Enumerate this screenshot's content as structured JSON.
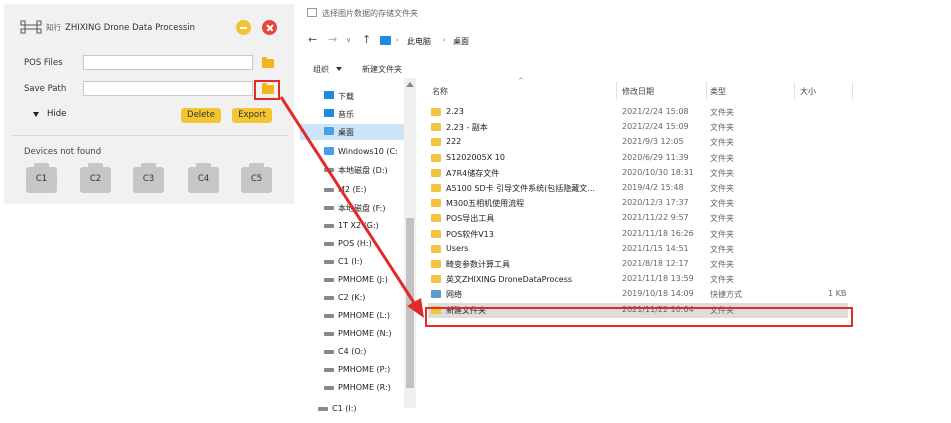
{
  "app": {
    "title": "ZHIXING Drone Data Processin",
    "logo_text": "知行",
    "pos_files_label": "POS Files",
    "pos_files_value": "",
    "save_path_label": "Save Path",
    "save_path_value": "",
    "hide_label": "Hide",
    "delete_label": "Delete",
    "export_label": "Export",
    "devices_title": "Devices not found",
    "devices": [
      "C1",
      "C2",
      "C3",
      "C4",
      "C5"
    ]
  },
  "explorer": {
    "title": "选择图片数据的存储文件夹",
    "breadcrumb": [
      "此电脑",
      "桌面"
    ],
    "organize_label": "组织",
    "new_folder_label": "新建文件夹",
    "columns": [
      "名称",
      "修改日期",
      "类型",
      "大小"
    ],
    "nav_items": [
      {
        "label": "下载",
        "icon": "download-icon"
      },
      {
        "label": "音乐",
        "icon": "music-icon"
      },
      {
        "label": "桌面",
        "icon": "desktop-icon",
        "selected": true
      },
      {
        "label": "Windows10 (C:",
        "icon": "windows-drive-icon"
      },
      {
        "label": "本地磁盘 (D:)",
        "icon": "drive-icon"
      },
      {
        "label": "M2 (E:)",
        "icon": "drive-icon"
      },
      {
        "label": "本地磁盘 (F:)",
        "icon": "drive-icon"
      },
      {
        "label": "1T X2 (G:)",
        "icon": "drive-icon"
      },
      {
        "label": "POS (H:)",
        "icon": "drive-icon"
      },
      {
        "label": "C1 (I:)",
        "icon": "drive-icon"
      },
      {
        "label": "PMHOME (J:)",
        "icon": "drive-icon"
      },
      {
        "label": "C2 (K:)",
        "icon": "drive-icon"
      },
      {
        "label": "PMHOME (L:)",
        "icon": "drive-icon"
      },
      {
        "label": "PMHOME (N:)",
        "icon": "drive-icon"
      },
      {
        "label": "C4 (O:)",
        "icon": "drive-icon"
      },
      {
        "label": "PMHOME (P:)",
        "icon": "drive-icon"
      },
      {
        "label": "PMHOME (R:)",
        "icon": "drive-icon"
      },
      {
        "label": "C1 (I:)",
        "icon": "drive-icon"
      }
    ],
    "files": [
      {
        "name": "2.23",
        "date": "2021/2/24 15:08",
        "type": "文件夹",
        "size": ""
      },
      {
        "name": "2.23 - 副本",
        "date": "2021/2/24 15:09",
        "type": "文件夹",
        "size": ""
      },
      {
        "name": "222",
        "date": "2021/9/3 12:05",
        "type": "文件夹",
        "size": ""
      },
      {
        "name": "S1202005X 10",
        "date": "2020/6/29 11:39",
        "type": "文件夹",
        "size": ""
      },
      {
        "name": "A7R4储存文件",
        "date": "2020/10/30 18:31",
        "type": "文件夹",
        "size": ""
      },
      {
        "name": "A5100 SD卡 引导文件系统(包括隐藏文...",
        "date": "2019/4/2 15:48",
        "type": "文件夹",
        "size": ""
      },
      {
        "name": "M300五相机使用流程",
        "date": "2020/12/3 17:37",
        "type": "文件夹",
        "size": ""
      },
      {
        "name": "POS导出工具",
        "date": "2021/11/22 9:57",
        "type": "文件夹",
        "size": ""
      },
      {
        "name": "POS软件V13",
        "date": "2021/11/18 16:26",
        "type": "文件夹",
        "size": ""
      },
      {
        "name": "Users",
        "date": "2021/1/15 14:51",
        "type": "文件夹",
        "size": ""
      },
      {
        "name": "畸变参数计算工具",
        "date": "2021/8/18 12:17",
        "type": "文件夹",
        "size": ""
      },
      {
        "name": "英文ZHIXING DroneDataProcess",
        "date": "2021/11/18 13:59",
        "type": "文件夹",
        "size": ""
      },
      {
        "name": "网络",
        "date": "2019/10/18 14:09",
        "type": "快捷方式",
        "size": "1 KB",
        "link": true
      },
      {
        "name": "新建文件夹",
        "date": "2021/11/22 10:04",
        "type": "文件夹",
        "size": "",
        "selected": true
      }
    ]
  },
  "colors": {
    "accent_yellow": "#f3c531",
    "highlight_red": "#e02b2b",
    "folder": "#f5c344",
    "selection_blue": "#cce4f7"
  }
}
